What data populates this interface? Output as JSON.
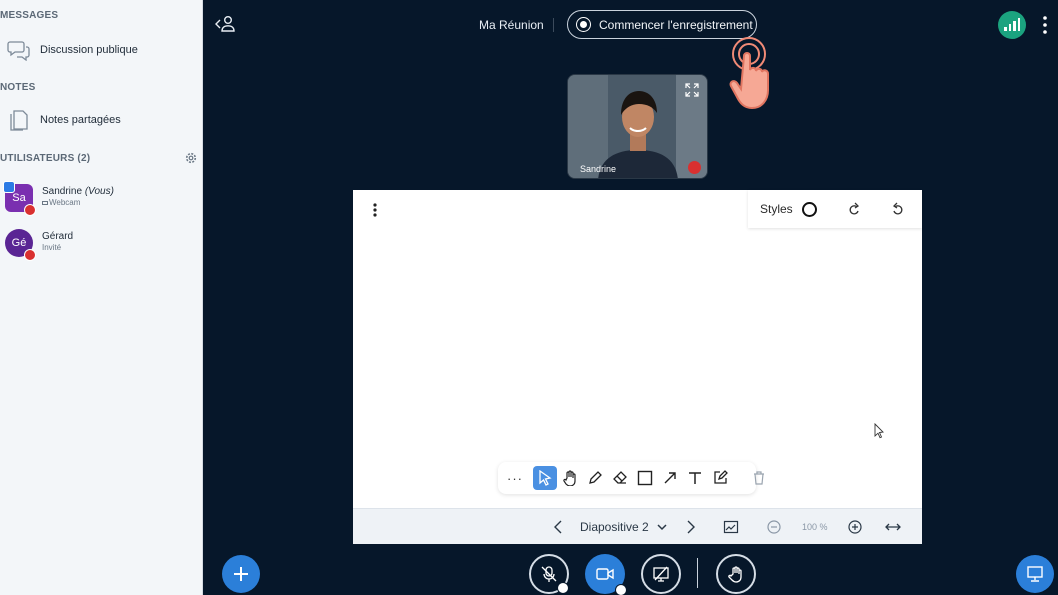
{
  "sidebar": {
    "messages_title": "MESSAGES",
    "public_chat": "Discussion publique",
    "notes_title": "NOTES",
    "shared_notes": "Notes partagées",
    "users_title": "UTILISATEURS (2)",
    "users": [
      {
        "initials": "Sa",
        "name": "Sandrine",
        "suffix": "(Vous)",
        "sub": "Webcam",
        "color": "#7a2fb0"
      },
      {
        "initials": "Gé",
        "name": "Gérard",
        "suffix": "",
        "sub": "Invité",
        "color": "#5a2594"
      }
    ]
  },
  "topbar": {
    "meeting_name": "Ma Réunion",
    "record_label": "Commencer l'enregistrement"
  },
  "webcam": {
    "name": "Sandrine"
  },
  "whiteboard": {
    "styles_label": "Styles",
    "more_label": "···",
    "slide_label": "Diapositive 2",
    "zoom": "100 %"
  },
  "colors": {
    "background": "#06172a",
    "accent": "#2b7fd9",
    "connection": "#1ba37f",
    "muted": "#d93030"
  }
}
